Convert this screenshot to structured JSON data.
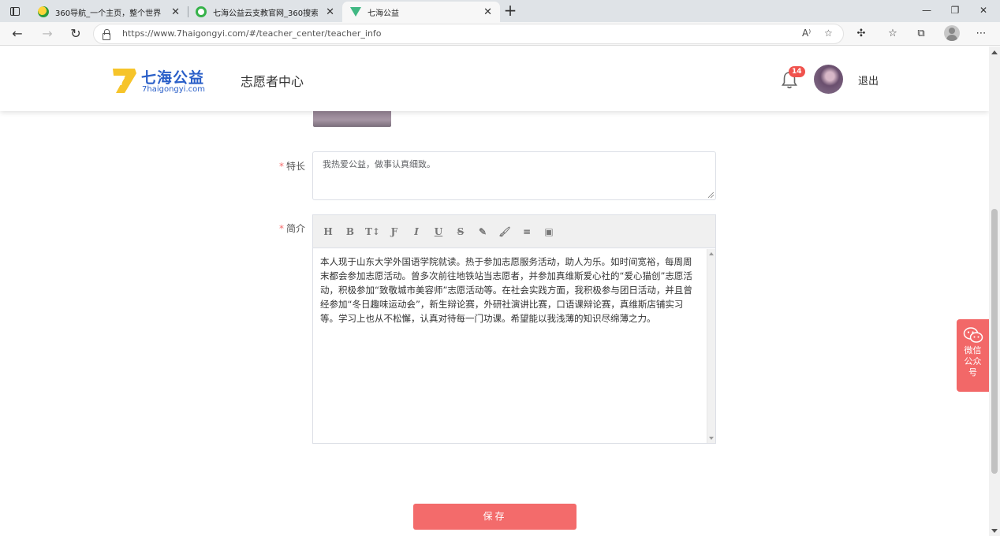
{
  "browser": {
    "tabs": [
      {
        "title": "360导航_一个主页，整个世界",
        "active": false
      },
      {
        "title": "七海公益云支教官网_360搜索",
        "active": false
      },
      {
        "title": "七海公益",
        "active": true
      }
    ],
    "new_tab": "+",
    "window_controls": {
      "minimize": "—",
      "maximize": "❐",
      "close": "✕"
    },
    "url": "https://www.7haigongyi.com/#/teacher_center/teacher_info",
    "read_aloud": "A⁾"
  },
  "header": {
    "logo_number": "7",
    "logo_name": "七海公益",
    "logo_domain": "7haigongyi.com",
    "center_title": "志愿者中心",
    "notification_count": "14",
    "logout_label": "退出"
  },
  "form": {
    "specialty": {
      "required_mark": "*",
      "label": "特长",
      "value": "我热爱公益，做事认真细致。"
    },
    "intro": {
      "required_mark": "*",
      "label": "简介",
      "toolbar": [
        "H",
        "B",
        "T↕",
        "Ƒ",
        "I",
        "U",
        "S",
        "✎",
        "🖌",
        "≡",
        "▣"
      ],
      "content": "本人现于山东大学外国语学院就读。热于参加志愿服务活动，助人为乐。如时间宽裕，每周周末都会参加志愿活动。曾多次前往地铁站当志愿者，并参加真维斯爱心社的“爱心猫创”志愿活动，积极参加“致敬城市美容师”志愿活动等。在社会实践方面，我积极参与团日活动，并且曾经参加“冬日趣味运动会”，新生辩论赛，外研社演讲比赛，口语课辩论赛，真维斯店铺实习等。学习上也从不松懈，认真对待每一门功课。希望能以我浅薄的知识尽绵薄之力。"
    },
    "save_label": "保存"
  },
  "float": {
    "wechat_label": "微信公众号"
  },
  "colors": {
    "accent": "#f36b6b",
    "brand_blue": "#2a5fc8",
    "logo_yellow": "#f6c42a",
    "required": "#f56c6c"
  }
}
